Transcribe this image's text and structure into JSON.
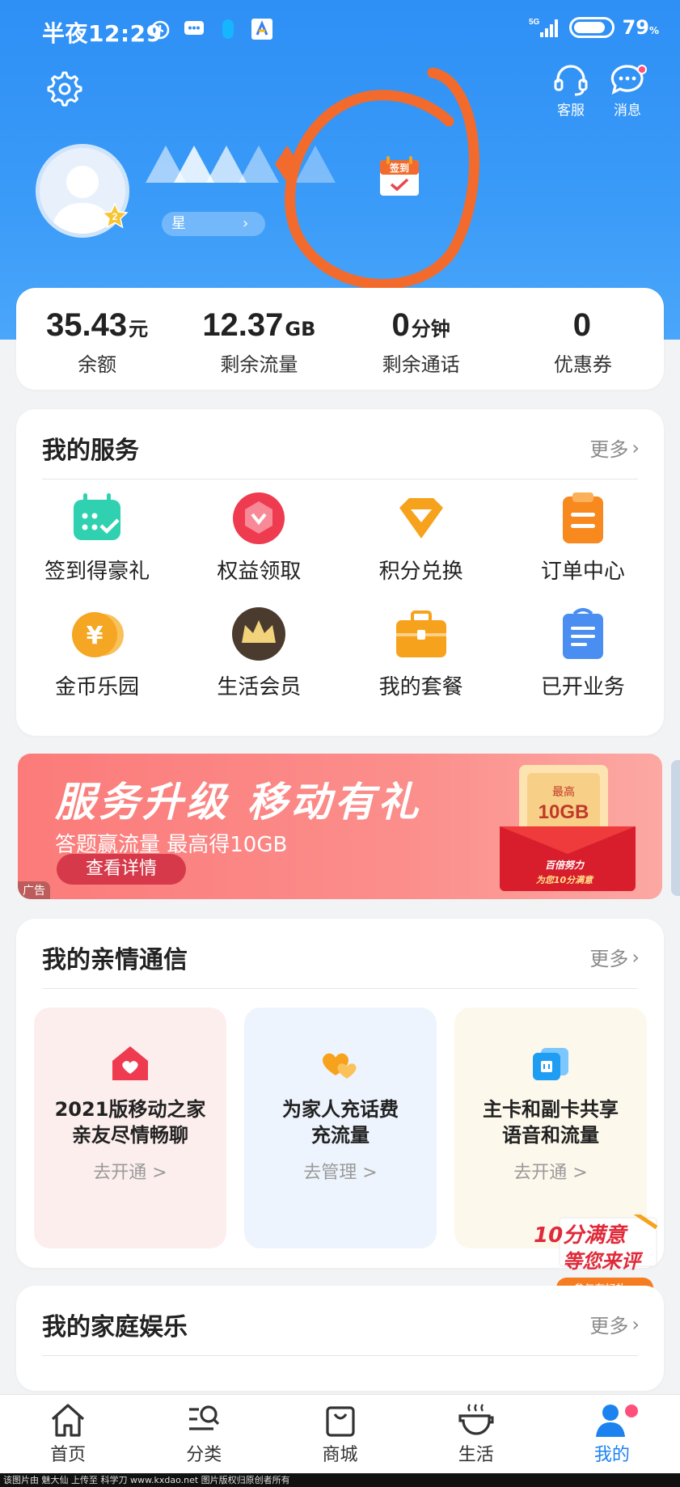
{
  "status_bar": {
    "time": "半夜12:29",
    "network": "5G",
    "battery": "79",
    "battery_unit": "%"
  },
  "header": {
    "service_label": "客服",
    "message_label": "消息",
    "user_level": "2",
    "member_pill": "星",
    "checkin_badge": "签到"
  },
  "stats": [
    {
      "value": "35.43",
      "unit": "元",
      "label": "余额"
    },
    {
      "value": "12.37",
      "unit": "GB",
      "label": "剩余流量"
    },
    {
      "value": "0",
      "unit": "分钟",
      "label": "剩余通话"
    },
    {
      "value": "0",
      "unit": "",
      "label": "优惠券"
    }
  ],
  "my_services": {
    "title": "我的服务",
    "more": "更多",
    "items": [
      {
        "label": "签到得豪礼",
        "icon": "calendar-check-icon",
        "color": "#2fd1b0"
      },
      {
        "label": "权益领取",
        "icon": "badge-ribbon-icon",
        "color": "#ef3b4f"
      },
      {
        "label": "积分兑换",
        "icon": "diamond-icon",
        "color": "#f7a21c"
      },
      {
        "label": "订单中心",
        "icon": "clipboard-icon",
        "color": "#f7891f"
      },
      {
        "label": "金币乐园",
        "icon": "yen-coin-icon",
        "color": "#f5a623"
      },
      {
        "label": "生活会员",
        "icon": "crown-icon",
        "color": "#4a3b2e"
      },
      {
        "label": "我的套餐",
        "icon": "briefcase-icon",
        "color": "#f7a21c"
      },
      {
        "label": "已开业务",
        "icon": "document-bag-icon",
        "color": "#4a8ef2"
      }
    ]
  },
  "banner": {
    "title": "服务升级 移动有礼",
    "subtitle": "答题赢流量  最高得10GB",
    "button": "查看详情",
    "ad_tag": "广告",
    "gift_top": "最高",
    "gift_amount": "10GB",
    "gift_slogan": "百倍努力",
    "gift_slogan2": "为您10分满意"
  },
  "family": {
    "title": "我的亲情通信",
    "more": "更多",
    "cards": [
      {
        "line1": "2021版移动之家",
        "line2": "亲友尽情畅聊",
        "action": "去开通 >",
        "bg": "#fdeeee",
        "icon": "home-heart-icon"
      },
      {
        "line1": "为家人充话费",
        "line2": "充流量",
        "action": "去管理 >",
        "bg": "#eef4fd",
        "icon": "double-heart-icon"
      },
      {
        "line1": "主卡和副卡共享",
        "line2": "语音和流量",
        "action": "去开通 >",
        "bg": "#fdf8ec",
        "icon": "sim-cards-icon"
      }
    ]
  },
  "float_promo": {
    "line1": "10分满意",
    "line2": "等您来评",
    "button": "参与有好礼"
  },
  "entertainment": {
    "title": "我的家庭娱乐",
    "more": "更多"
  },
  "tabbar": [
    {
      "label": "首页",
      "icon": "home-icon"
    },
    {
      "label": "分类",
      "icon": "category-search-icon"
    },
    {
      "label": "商城",
      "icon": "shopping-bag-icon"
    },
    {
      "label": "生活",
      "icon": "coffee-cup-icon"
    },
    {
      "label": "我的",
      "icon": "user-icon",
      "active": true
    }
  ],
  "watermark": "该图片由 魅大仙 上传至 科学刀 www.kxdao.net 图片版权归原创者所有"
}
